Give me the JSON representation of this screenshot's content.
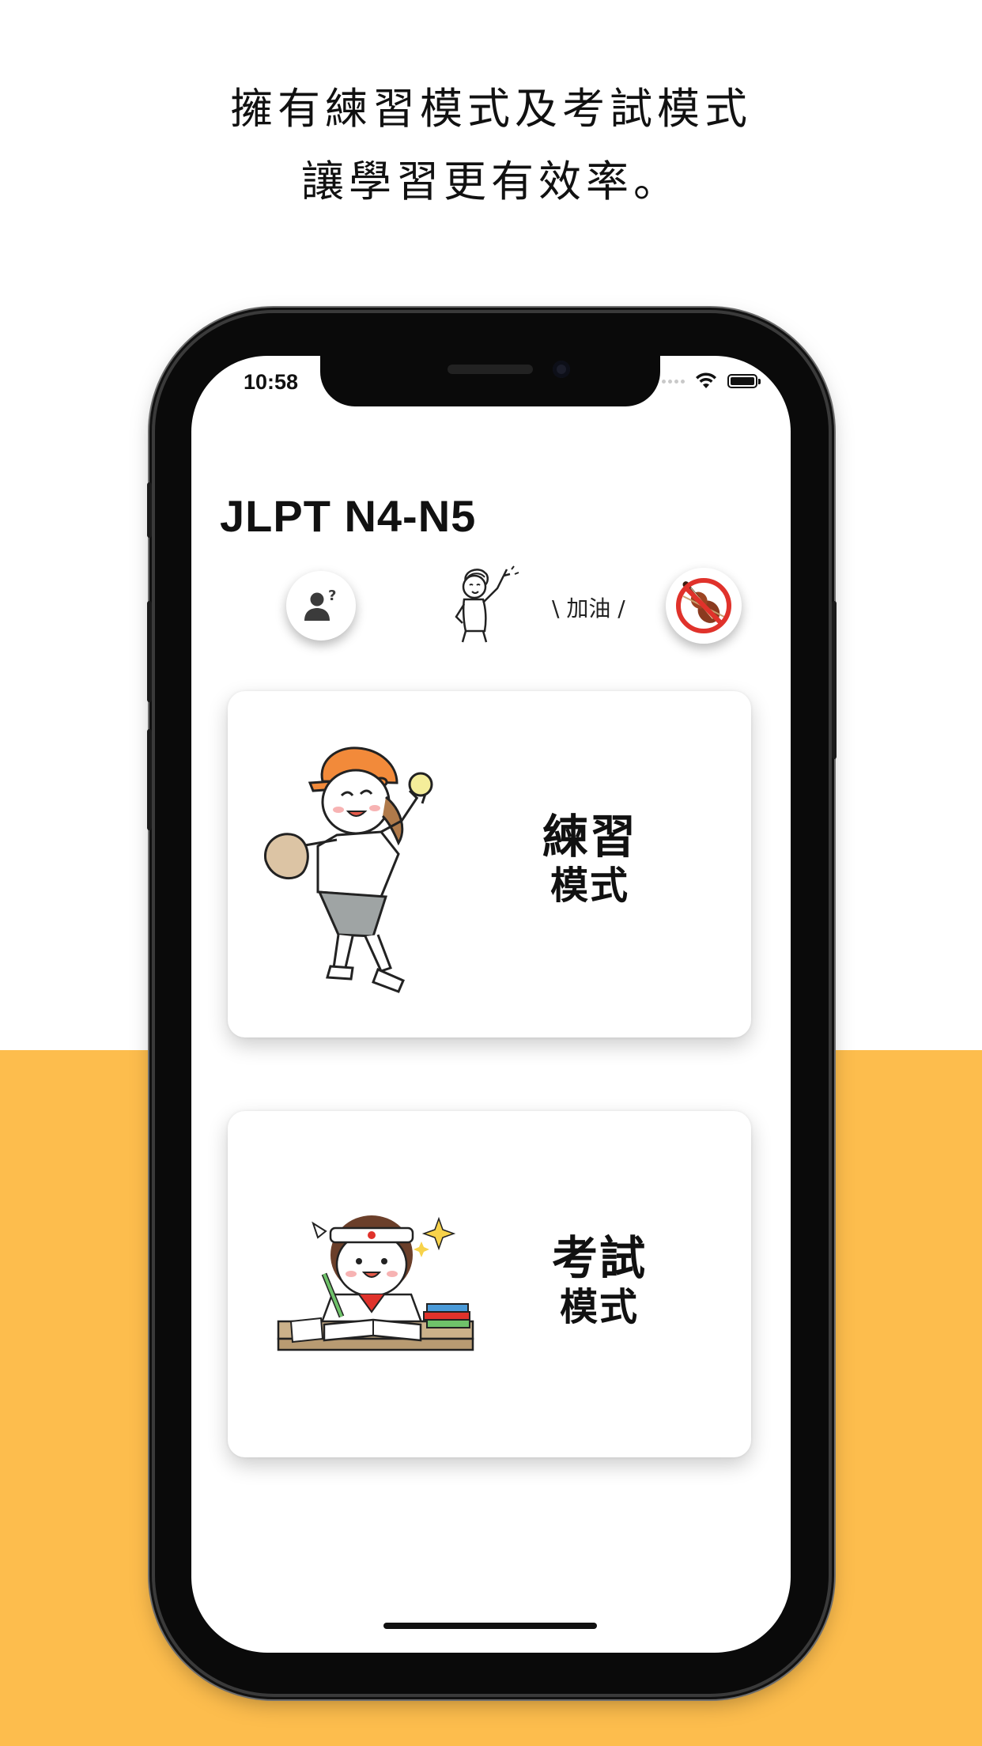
{
  "headline": {
    "line1": "擁有練習模式及考試模式",
    "line2": "讓學習更有效率。"
  },
  "status_bar": {
    "time": "10:58"
  },
  "app": {
    "title": "JLPT N4-N5",
    "cheer_text": "\\ 加油 /"
  },
  "cards": {
    "practice": {
      "line1": "練習",
      "line2": "模式"
    },
    "exam": {
      "line1": "考試",
      "line2": "模式"
    }
  },
  "colors": {
    "accent_yellow": "#FDBD4D",
    "cap_orange": "#F28A3A",
    "no_sign_red": "#E0322B"
  },
  "icons": {
    "profile": "user-question-icon",
    "mute_music": "no-violin-icon",
    "wifi": "wifi-icon",
    "battery": "battery-icon"
  }
}
